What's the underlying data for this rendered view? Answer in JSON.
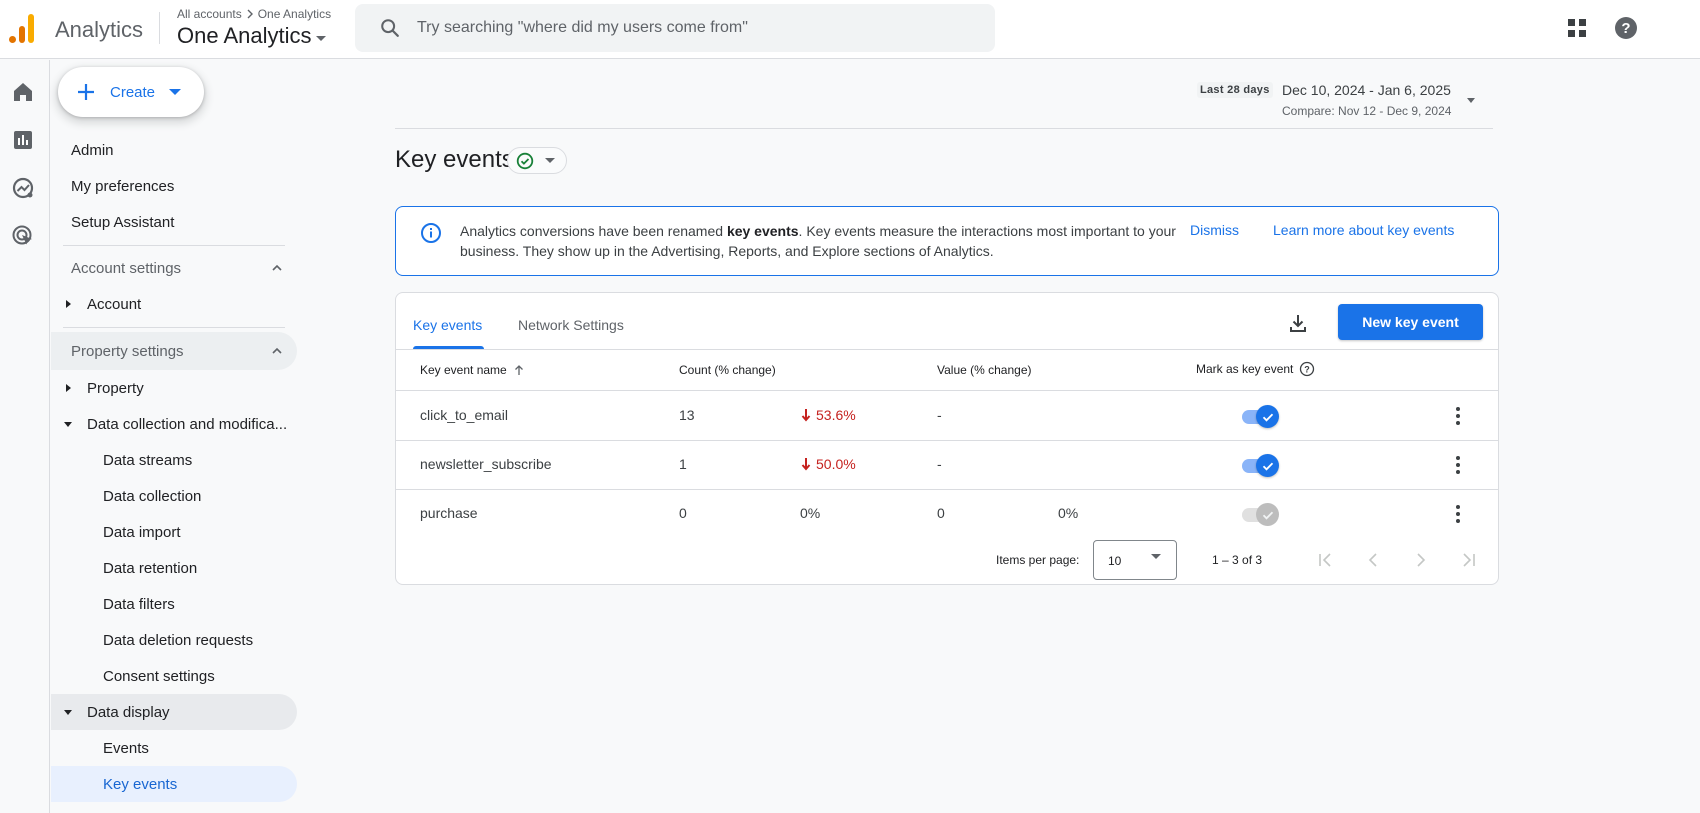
{
  "header": {
    "app_name": "Analytics",
    "breadcrumb": [
      "All accounts",
      "One Analytics"
    ],
    "property_name": "One Analytics",
    "search_placeholder": "Try searching \"where did my users come from\""
  },
  "rail": {
    "items": [
      "home-icon",
      "reports-icon",
      "explore-icon",
      "advertising-icon"
    ]
  },
  "sidebar": {
    "create_label": "Create",
    "top_items": [
      "Admin",
      "My preferences",
      "Setup Assistant"
    ],
    "account_settings": {
      "label": "Account settings",
      "items": [
        "Account"
      ]
    },
    "property_settings": {
      "label": "Property settings",
      "property": "Property",
      "data_collection_group": "Data collection and modifica...",
      "data_collection_items": [
        "Data streams",
        "Data collection",
        "Data import",
        "Data retention",
        "Data filters",
        "Data deletion requests",
        "Consent settings"
      ],
      "data_display_group": "Data display",
      "data_display_items": [
        "Events",
        "Key events"
      ],
      "active_item": "Key events"
    }
  },
  "date_range": {
    "preset": "Last 28 days",
    "range": "Dec 10, 2024 - Jan 6, 2025",
    "compare": "Compare: Nov 12 - Dec 9, 2024"
  },
  "page": {
    "title": "Key events",
    "status": "ok"
  },
  "banner": {
    "text_before": "Analytics conversions have been renamed ",
    "text_bold": "key events",
    "text_after": ". Key events measure the interactions most important to your business. They show up in the Advertising, Reports, and Explore sections of Analytics.",
    "dismiss": "Dismiss",
    "learn_more": "Learn more about key events"
  },
  "card": {
    "tabs": [
      "Key events",
      "Network Settings"
    ],
    "active_tab": "Key events",
    "new_button": "New key event",
    "columns": [
      "Key event name",
      "Count (% change)",
      "Value (% change)",
      "Mark as key event"
    ],
    "rows": [
      {
        "name": "click_to_email",
        "count": "13",
        "count_change": "53.6%",
        "count_trend": "down",
        "value": "-",
        "value_change": "",
        "marked": true
      },
      {
        "name": "newsletter_subscribe",
        "count": "1",
        "count_change": "50.0%",
        "count_trend": "down",
        "value": "-",
        "value_change": "",
        "marked": true
      },
      {
        "name": "purchase",
        "count": "0",
        "count_change": "0%",
        "count_trend": "none",
        "value": "0",
        "value_change": "0%",
        "marked": true,
        "disabled": true
      }
    ],
    "pagination": {
      "items_per_page_label": "Items per page:",
      "items_per_page": "10",
      "range": "1 – 3 of 3"
    }
  },
  "colors": {
    "accent": "#1a73e8",
    "negative": "#c5221f",
    "success": "#188038"
  }
}
